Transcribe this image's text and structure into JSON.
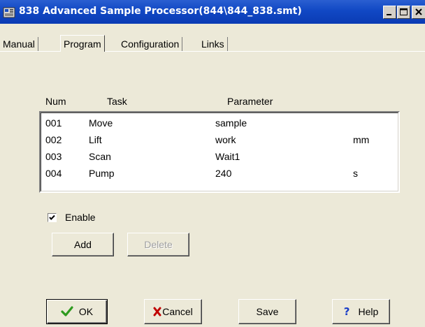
{
  "window": {
    "title": "838 Advanced Sample Processor(844\\844_838.smt)",
    "app_icon": "instrument-icon",
    "controls": [
      "minimize-icon",
      "maximize-icon",
      "close-icon"
    ]
  },
  "tabs": [
    {
      "label": "Manual",
      "active": false
    },
    {
      "label": "Program",
      "active": true
    },
    {
      "label": "Configuration",
      "active": false
    },
    {
      "label": "Links",
      "active": false
    }
  ],
  "list": {
    "columns": {
      "num": "Num",
      "task": "Task",
      "parameter": "Parameter"
    },
    "rows": [
      {
        "num": "001",
        "task": "Move",
        "parameter": "sample",
        "unit": ""
      },
      {
        "num": "002",
        "task": "Lift",
        "parameter": "work",
        "unit": "mm"
      },
      {
        "num": "003",
        "task": "Scan",
        "parameter": "Wait1",
        "unit": ""
      },
      {
        "num": "004",
        "task": "Pump",
        "parameter": "240",
        "unit": "s"
      }
    ]
  },
  "enable": {
    "label": "Enable",
    "checked": true
  },
  "buttons": {
    "add": "Add",
    "delete": "Delete",
    "ok": "OK",
    "cancel": "Cancel",
    "save": "Save",
    "help": "Help"
  },
  "colors": {
    "titlebar": "#0a3bb4",
    "ok_check": "#2e9a1f",
    "cancel_x": "#c00000",
    "help_q": "#1a3ec8"
  }
}
